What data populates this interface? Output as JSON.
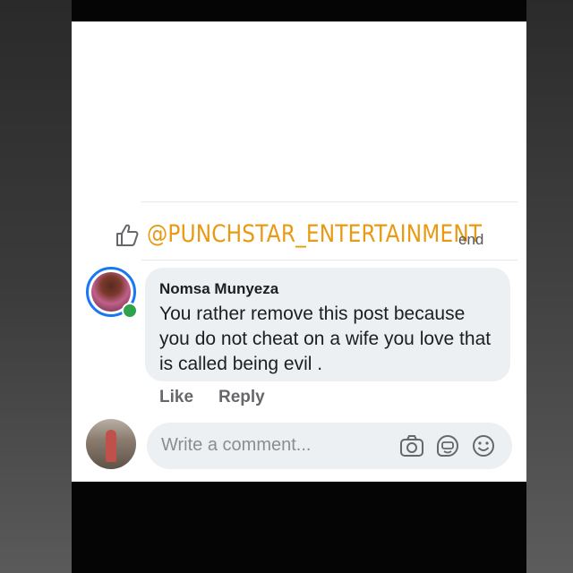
{
  "post": {
    "watermark": "@PUNCHSTAR_ENTERTAINMENT",
    "send_label": "end"
  },
  "comment": {
    "author": "Nomsa Munyeza",
    "text": "You rather remove this post because you do not cheat on a wife you love that is called being evil .",
    "like_label": "Like",
    "reply_label": "Reply"
  },
  "composer": {
    "placeholder": "Write a comment..."
  },
  "icons": [
    "like-icon",
    "camera-icon",
    "gif-sticker-icon",
    "emoji-icon"
  ],
  "colors": {
    "watermark": "#e89a12",
    "online": "#31a24c",
    "accent": "#1877f2"
  }
}
